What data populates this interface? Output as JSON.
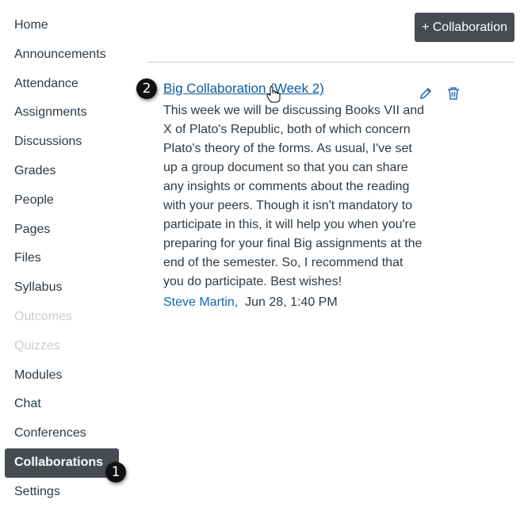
{
  "sidebar": {
    "items": [
      {
        "label": "Home"
      },
      {
        "label": "Announcements"
      },
      {
        "label": "Attendance"
      },
      {
        "label": "Assignments"
      },
      {
        "label": "Discussions"
      },
      {
        "label": "Grades"
      },
      {
        "label": "People"
      },
      {
        "label": "Pages"
      },
      {
        "label": "Files"
      },
      {
        "label": "Syllabus"
      },
      {
        "label": "Outcomes"
      },
      {
        "label": "Quizzes"
      },
      {
        "label": "Modules"
      },
      {
        "label": "Chat"
      },
      {
        "label": "Conferences"
      },
      {
        "label": "Collaborations"
      },
      {
        "label": "Settings"
      }
    ]
  },
  "toolbar": {
    "add_label": "+ Collaboration"
  },
  "collaboration": {
    "title": "Big Collaboration (Week 2)",
    "description": "This week we will be discussing Books VII and X of Plato's Republic, both of which concern Plato's theory of the forms. As usual, I've set up a group document so that you can share any insights or comments about the reading with your peers. Though it isn't mandatory to participate in this, it will help you when you're preparing for your final Big assignments at the end of the semester. So, I recommend that you do participate. Best wishes!",
    "author": "Steve Martin,",
    "date": "Jun 28, 1:40 PM",
    "icons": {
      "edit": "pencil-icon",
      "delete": "trash-icon"
    }
  },
  "callouts": {
    "one": "1",
    "two": "2"
  }
}
